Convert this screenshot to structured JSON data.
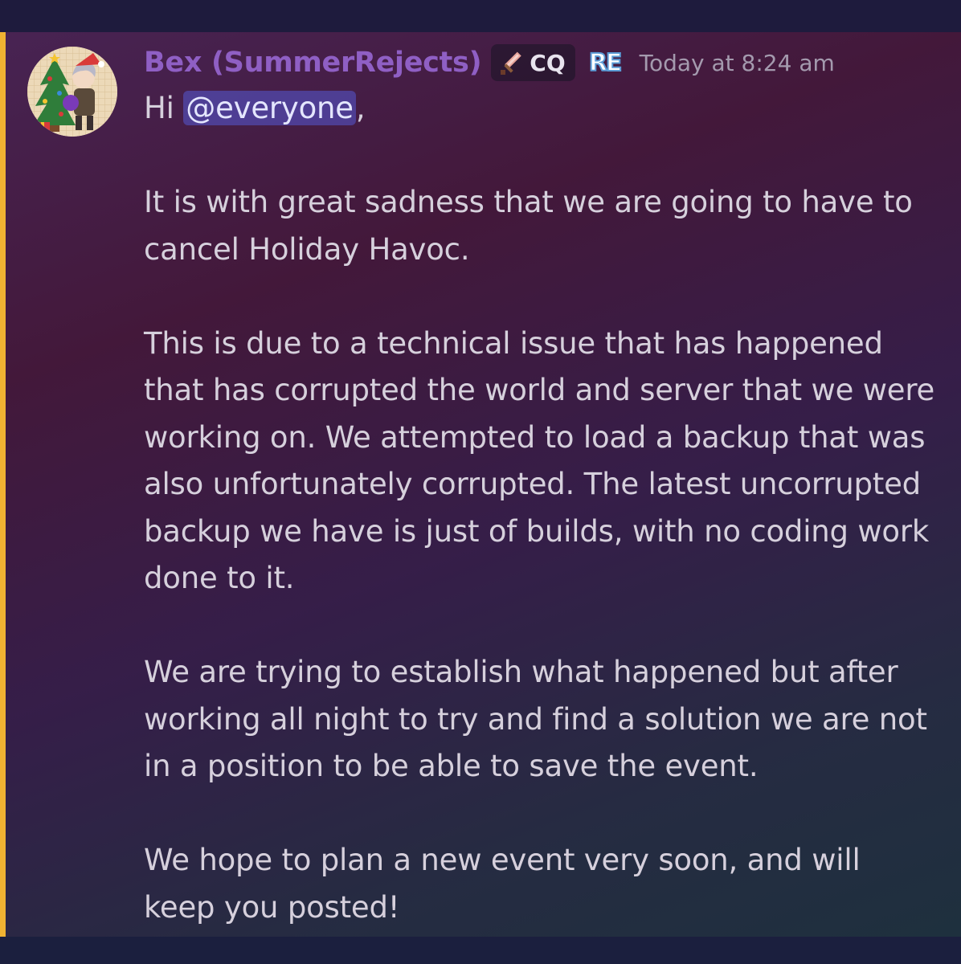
{
  "message": {
    "author": "Bex (SummerRejects)",
    "role_tag": "CQ",
    "badge": "RE",
    "timestamp": "Today at 8:24 am",
    "greeting_prefix": "Hi ",
    "mention": "@everyone",
    "greeting_suffix": ",",
    "paragraphs": [
      "It is with great sadness that we are going to have to cancel Holiday Havoc.",
      "This is due to a technical issue that has happened that has corrupted the world and server that we were working on. We attempted to load a backup that was also unfortunately corrupted. The latest uncorrupted backup we have is just of builds, with no coding work done to it.",
      "We are trying to establish what happened but after working all night to try and find a solution we are not in a position to be able to save the event.",
      "We hope to plan a new event very soon, and will keep you posted!"
    ]
  },
  "icons": {
    "avatar": "christmas-avatar",
    "role": "sword-icon",
    "badge": "re-badge-icon"
  },
  "colors": {
    "username": "#8f5fc4",
    "mention_bar": "#f0b232",
    "mention_bg": "#5865f2",
    "text": "#d6d0dc",
    "timestamp": "#a49aae"
  }
}
